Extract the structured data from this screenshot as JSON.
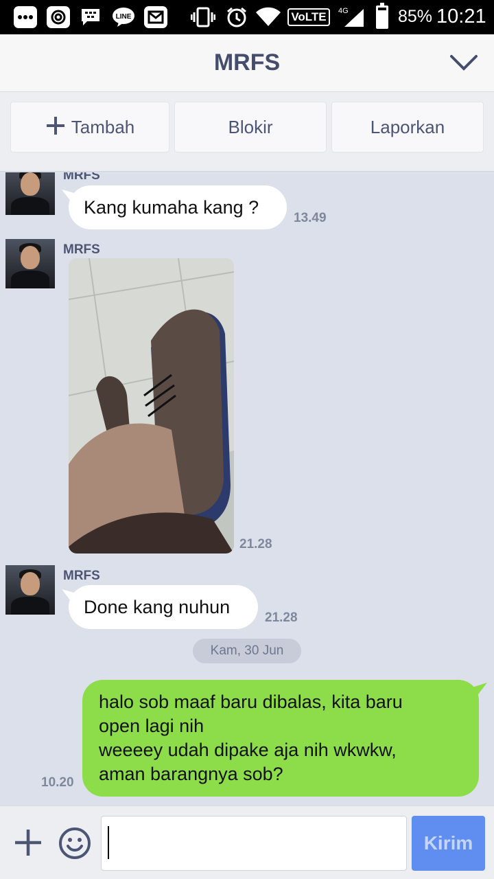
{
  "status_bar": {
    "battery_percent_label": "85%",
    "battery_level": 0.85,
    "clock": "10:21",
    "volte_label": "VoLTE",
    "network_label": "4G",
    "left_icons": [
      "more-icon",
      "at-icon",
      "bbm-icon",
      "line-icon",
      "gmail-icon"
    ],
    "right_icons": [
      "vibrate-icon",
      "alarm-icon",
      "wifi-icon",
      "volte-icon",
      "signal-icon",
      "battery-icon"
    ]
  },
  "header": {
    "title": "MRFS"
  },
  "actions": {
    "add_label": "Tambah",
    "block_label": "Blokir",
    "report_label": "Laporkan"
  },
  "messages": [
    {
      "sender": "MRFS",
      "text": "Kang kumaha kang ?",
      "time": "13.49"
    },
    {
      "sender": "MRFS",
      "type": "image",
      "description_icon": "shoe-photo",
      "time": "21.28"
    },
    {
      "sender": "MRFS",
      "text": "Done kang nuhun",
      "time": "21.28"
    }
  ],
  "date_divider": "Kam, 30 Jun",
  "outgoing": {
    "lines": [
      "halo sob maaf baru dibalas, kita baru",
      "open lagi nih",
      "weeeey udah dipake aja nih wkwkw,",
      "aman barangnya sob?"
    ],
    "time": "10.20"
  },
  "input_bar": {
    "placeholder": "",
    "value": "",
    "send_label": "Kirim"
  },
  "colors": {
    "header_title": "#454d6d",
    "chat_background": "#dce0ea",
    "outgoing_bubble": "#8ddd4b",
    "send_button": "#5f8ef0"
  }
}
